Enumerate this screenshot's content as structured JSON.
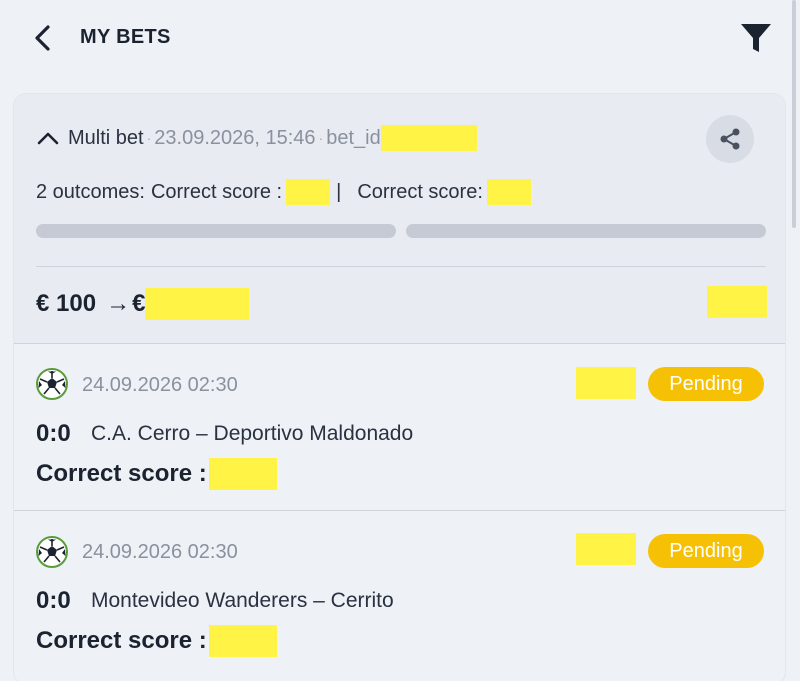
{
  "header": {
    "title": "MY BETS",
    "back_icon": "chevron-left-icon",
    "filter_icon": "filter-icon"
  },
  "bet": {
    "type": "Multi bet",
    "datetime": "23.09.2026, 15:46",
    "id_label": "bet_id",
    "outcomes_text": "2 outcomes:",
    "outcome_1_label": "Correct score :",
    "outcome_separator": "|",
    "outcome_2_label": "Correct score:",
    "stake": "€ 100",
    "arrow": "→",
    "payout_currency": "€",
    "progress": [
      0.0,
      0.0
    ]
  },
  "events": [
    {
      "sport_icon": "soccer-ball-icon",
      "date": "24.09.2026 02:30",
      "status": "Pending",
      "score": "0:0",
      "teams": "C.A. Cerro – Deportivo Maldonado",
      "market": "Correct score :"
    },
    {
      "sport_icon": "soccer-ball-icon",
      "date": "24.09.2026 02:30",
      "status": "Pending",
      "score": "0:0",
      "teams": "Montevideo Wanderers – Cerrito",
      "market": "Correct score :"
    }
  ],
  "colors": {
    "background": "#eef1f6",
    "pending_badge": "#f6c105",
    "redaction": "#fff345",
    "progress_track": "#c5cad4"
  }
}
